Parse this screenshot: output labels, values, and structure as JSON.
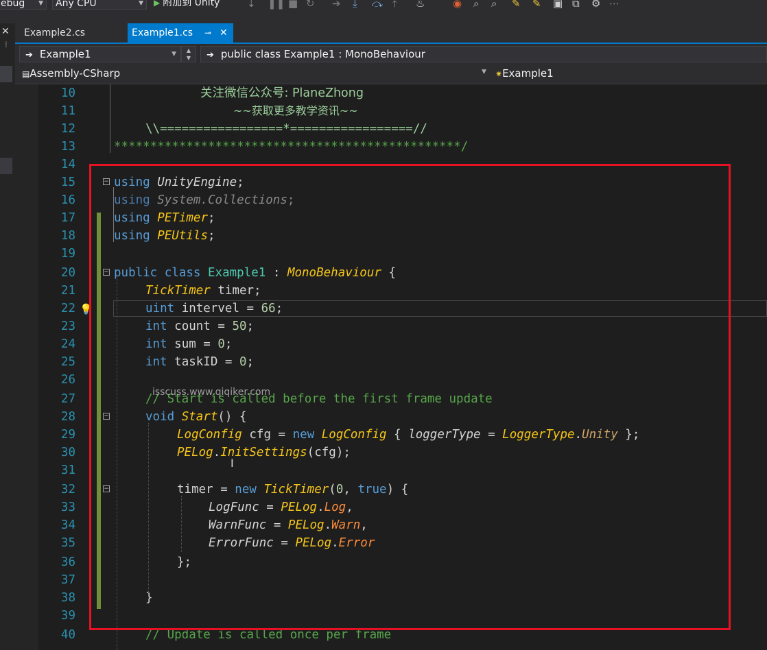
{
  "toolbar": {
    "config": "ebug",
    "platform": "Any CPU",
    "attach": "附加到 Unity"
  },
  "tabs": [
    {
      "label": "Example2.cs",
      "active": false
    },
    {
      "label": "Example1.cs",
      "active": true
    }
  ],
  "navbar": {
    "class_selector": "Example1",
    "member_selector": "public class Example1 : MonoBehaviour",
    "project": "Assembly-CSharp",
    "scope": "Example1"
  },
  "overlay": {
    "watermark": "isscuss.www.qiqiker.com"
  },
  "colors": {
    "accent": "#007acc",
    "highlight_box": "#e81123",
    "change_bar": "#6f8f3a"
  },
  "code_lines": [
    {
      "n": "10",
      "text": "关注微信公众号: PlaneZhong"
    },
    {
      "n": "11",
      "text": "~~获取更多教学资讯~~"
    },
    {
      "n": "12",
      "text": "\\\\=================*=================//"
    },
    {
      "n": "13",
      "text": "************************************************/"
    },
    {
      "n": "14",
      "text": ""
    },
    {
      "n": "15",
      "text": "using UnityEngine;"
    },
    {
      "n": "16",
      "text": "using System.Collections;"
    },
    {
      "n": "17",
      "text": "using PETimer;"
    },
    {
      "n": "18",
      "text": "using PEUtils;"
    },
    {
      "n": "19",
      "text": ""
    },
    {
      "n": "20",
      "text": "public class Example1 : MonoBehaviour {"
    },
    {
      "n": "21",
      "text": "TickTimer timer;"
    },
    {
      "n": "22",
      "text": "uint intervel = 66;"
    },
    {
      "n": "23",
      "text": "int count = 50;"
    },
    {
      "n": "24",
      "text": "int sum = 0;"
    },
    {
      "n": "25",
      "text": "int taskID = 0;"
    },
    {
      "n": "26",
      "text": ""
    },
    {
      "n": "27",
      "text": "// Start is called before the first frame update"
    },
    {
      "n": "28",
      "text": "void Start() {"
    },
    {
      "n": "29",
      "text": "LogConfig cfg = new LogConfig { loggerType = LoggerType.Unity };"
    },
    {
      "n": "30",
      "text": "PELog.InitSettings(cfg);"
    },
    {
      "n": "31",
      "text": ""
    },
    {
      "n": "32",
      "text": "timer = new TickTimer(0, true) {"
    },
    {
      "n": "33",
      "text": "LogFunc = PELog.Log,"
    },
    {
      "n": "34",
      "text": "WarnFunc = PELog.Warn,"
    },
    {
      "n": "35",
      "text": "ErrorFunc = PELog.Error"
    },
    {
      "n": "36",
      "text": "};"
    },
    {
      "n": "37",
      "text": ""
    },
    {
      "n": "38",
      "text": "}"
    },
    {
      "n": "39",
      "text": ""
    },
    {
      "n": "40",
      "text": "// Update is called once per frame"
    }
  ]
}
